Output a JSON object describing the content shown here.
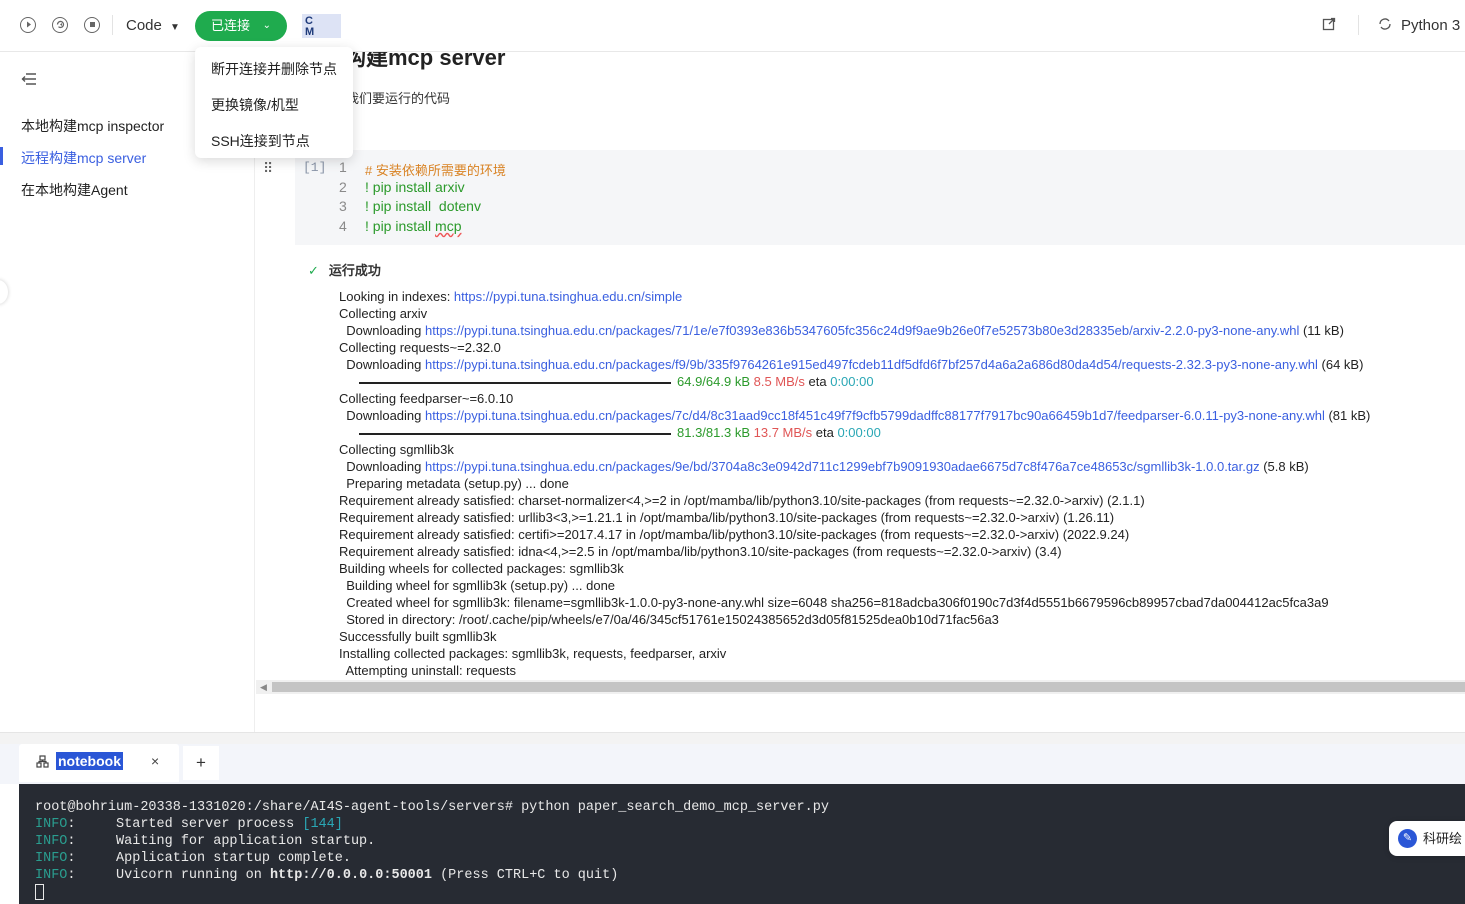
{
  "toolbar": {
    "code_mode": "Code",
    "connection_status": "已连接",
    "logo_text_top": "C",
    "logo_text_bottom": "M",
    "kernel": "Python 3"
  },
  "connection_menu": {
    "items": [
      "断开连接并删除节点",
      "更换镜像/机型",
      "SSH连接到节点"
    ]
  },
  "sidebar": {
    "items": [
      {
        "label": "本地构建mcp inspector",
        "active": false
      },
      {
        "label": "远程构建mcp server",
        "active": true
      },
      {
        "label": "在本地构建Agent",
        "active": false
      }
    ]
  },
  "notebook": {
    "heading": "构建mcp server",
    "paragraph": "我们要运行的代码",
    "cell": {
      "execution_count": "[1]",
      "line_numbers": [
        "1",
        "2",
        "3",
        "4"
      ],
      "lines": [
        "# 安装依赖所需要的环境",
        "! pip install arxiv",
        "! pip install  dotenv",
        "! pip install "
      ],
      "last_word": "mcp"
    },
    "run_status": "运行成功",
    "output": {
      "l1_text": "Looking in indexes: ",
      "l1_link": "https://pypi.tuna.tsinghua.edu.cn/simple",
      "l2": "Collecting arxiv",
      "l3_prefix": "  Downloading ",
      "l3_link": "https://pypi.tuna.tsinghua.edu.cn/packages/71/1e/e7f0393e836b5347605fc356c24d9f9ae9b26e0f7e52573b80e3d28335eb/arxiv-2.2.0-py3-none-any.whl",
      "l3_size": " (11 kB)",
      "l4": "Collecting requests~=2.32.0",
      "l5_prefix": "  Downloading ",
      "l5_link": "https://pypi.tuna.tsinghua.edu.cn/packages/f9/9b/335f9764261e915ed497fcdeb11df5dfd6f7bf257d4a6a2a686d80da4d54/requests-2.32.3-py3-none-any.whl",
      "l5_size": " (64 kB)",
      "p1_size": "64.9/64.9 kB",
      "p1_speed": "8.5 MB/s",
      "p1_eta_label": " eta ",
      "p1_eta": "0:00:00",
      "l7": "Collecting feedparser~=6.0.10",
      "l8_prefix": "  Downloading ",
      "l8_link": "https://pypi.tuna.tsinghua.edu.cn/packages/7c/d4/8c31aad9cc18f451c49f7f9cfb5799dadffc88177f7917bc90a66459b1d7/feedparser-6.0.11-py3-none-any.whl",
      "l8_size": " (81 kB)",
      "p2_size": "81.3/81.3 kB",
      "p2_speed": "13.7 MB/s",
      "p2_eta_label": " eta ",
      "p2_eta": "0:00:00",
      "l10": "Collecting sgmllib3k",
      "l11_prefix": "  Downloading ",
      "l11_link": "https://pypi.tuna.tsinghua.edu.cn/packages/9e/bd/3704a8c3e0942d711c1299ebf7b9091930adae6675d7c8f476a7ce48653c/sgmllib3k-1.0.0.tar.gz",
      "l11_size": " (5.8 kB)",
      "rest": "  Preparing metadata (setup.py) ... done\nRequirement already satisfied: charset-normalizer<4,>=2 in /opt/mamba/lib/python3.10/site-packages (from requests~=2.32.0->arxiv) (2.1.1)\nRequirement already satisfied: urllib3<3,>=1.21.1 in /opt/mamba/lib/python3.10/site-packages (from requests~=2.32.0->arxiv) (1.26.11)\nRequirement already satisfied: certifi>=2017.4.17 in /opt/mamba/lib/python3.10/site-packages (from requests~=2.32.0->arxiv) (2022.9.24)\nRequirement already satisfied: idna<4,>=2.5 in /opt/mamba/lib/python3.10/site-packages (from requests~=2.32.0->arxiv) (3.4)\nBuilding wheels for collected packages: sgmllib3k\n  Building wheel for sgmllib3k (setup.py) ... done\n  Created wheel for sgmllib3k: filename=sgmllib3k-1.0.0-py3-none-any.whl size=6048 sha256=818adcba306f0190c7d3f4d5551b6679596cb89957cbad7da004412ac5fca3a9\n  Stored in directory: /root/.cache/pip/wheels/e7/0a/46/345cf51761e15024385652d3d05f81525dea0b10d71fac56a3\nSuccessfully built sgmllib3k\nInstalling collected packages: sgmllib3k, requests, feedparser, arxiv\n  Attempting uninstall: requests"
    }
  },
  "terminal": {
    "tab_label": "notebook",
    "tab_close": "×",
    "tab_add": "+",
    "prompt_line": "root@bohrium-20338-1331020:/share/AI4S-agent-tools/servers# python paper_search_demo_mcp_server.py",
    "log": [
      {
        "level": "INFO",
        "sep": ":     ",
        "message": "Started server process ",
        "pid": "[144]"
      },
      {
        "level": "INFO",
        "sep": ":     ",
        "message": "Waiting for application startup."
      },
      {
        "level": "INFO",
        "sep": ":     ",
        "message": "Application startup complete."
      },
      {
        "level": "INFO",
        "sep": ":     ",
        "message": "Uvicorn running on ",
        "url": "http://0.0.0.0:50001",
        "tail": " (Press CTRL+C to quit)"
      }
    ]
  },
  "floating_widget": {
    "label": "科研绘"
  },
  "colors": {
    "accent": "#3a5fe0",
    "connected": "#1fab4e",
    "terminal_bg": "#272b33"
  }
}
